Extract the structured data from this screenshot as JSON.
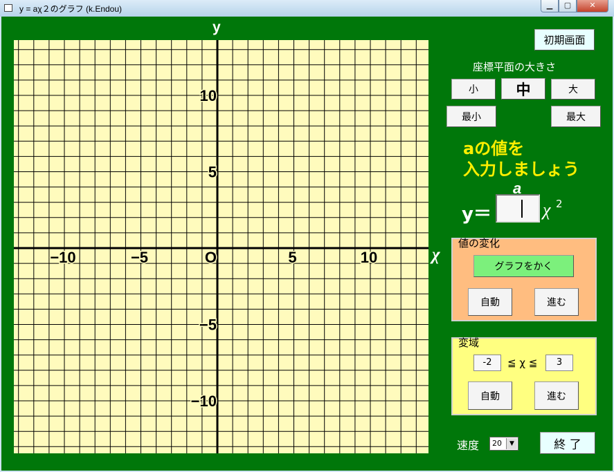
{
  "window": {
    "title": "y = aχ２のグラフ (k.Endou)",
    "controls": {
      "minimize": "▁",
      "maximize": "▢",
      "close": "✕"
    }
  },
  "graph": {
    "y_axis_name": "y",
    "x_axis_name": "χ",
    "origin_label": "O",
    "x_tick_labels": [
      "−10",
      "−5",
      "5",
      "10"
    ],
    "y_tick_labels": [
      "10",
      "5",
      "−5",
      "−10"
    ]
  },
  "chart_data": {
    "type": "line",
    "title": "y = aχ２のグラフ",
    "xlabel": "χ",
    "ylabel": "y",
    "xlim": [
      -13.5,
      13.5
    ],
    "ylim": [
      -13.5,
      13.5
    ],
    "x_ticks": [
      -10,
      -5,
      5,
      10
    ],
    "y_ticks": [
      10,
      5,
      -5,
      -10
    ],
    "grid": true,
    "grid_step": 1,
    "series": []
  },
  "buttons": {
    "initial_screen": "初期画面",
    "small": "小",
    "medium": "中",
    "large": "大",
    "smallest": "最小",
    "largest": "最大",
    "draw_graph": "グラフをかく",
    "auto_change": "自動",
    "step_change": "進む",
    "auto_domain": "自動",
    "step_domain": "進む",
    "exit": "終 了"
  },
  "labels": {
    "plane_size": "座標平面の大きさ",
    "prompt_line1": "aの値を",
    "prompt_line2": "入力しましょう",
    "eq_a": "a",
    "eq_y": "y＝",
    "eq_x": "χ",
    "eq_sup": "2",
    "change_group": "値の変化",
    "domain_group": "変域",
    "domain_ineq": "≦ χ ≦",
    "speed": "速度"
  },
  "inputs": {
    "a_value": "",
    "domain_min": "-2",
    "domain_max": "3",
    "speed": "20"
  },
  "colors": {
    "background": "#00770a",
    "plot_background": "#fffbbd",
    "prompt": "#ffef00",
    "change_frame": "#ffbd80",
    "domain_frame": "#ffff80",
    "draw_button": "#7cf07c"
  }
}
